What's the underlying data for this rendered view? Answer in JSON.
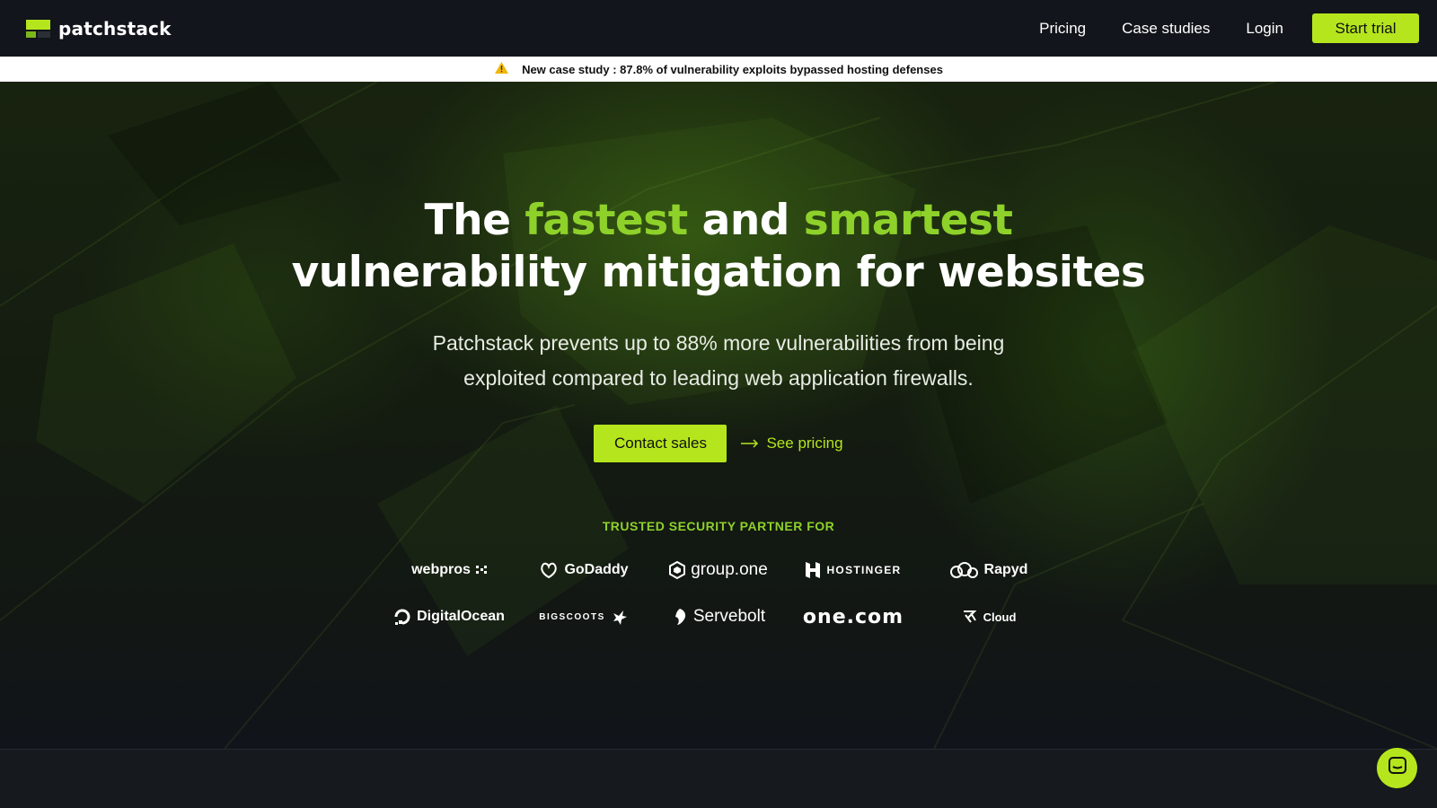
{
  "nav": {
    "brand": "patchstack",
    "links": [
      "Pricing",
      "Case studies",
      "Login"
    ],
    "cta": "Start trial"
  },
  "banner": {
    "text": "New case study : 87.8% of vulnerability exploits bypassed hosting defenses"
  },
  "hero": {
    "headline_parts": [
      "The ",
      "fastest",
      " and ",
      "smartest"
    ],
    "headline_line2": "vulnerability mitigation for websites",
    "subtitle": "Patchstack prevents up to 88% more vulnerabilities from being exploited compared to leading web application firewalls.",
    "contact_button": "Contact sales",
    "pricing_link": "See pricing",
    "trusted_label": "TRUSTED SECURITY PARTNER FOR"
  },
  "partners": [
    "webpros",
    "GoDaddy",
    "group.one",
    "HOSTINGER",
    "Rapyd",
    "DigitalOcean",
    "BIGSCOOTS",
    "Servebolt",
    "one.com",
    "Cloud"
  ],
  "colors": {
    "accent": "#b5e61d",
    "headline_green": "#8ed12a",
    "nav_bg": "#12151b",
    "warning": "#e0a800"
  }
}
